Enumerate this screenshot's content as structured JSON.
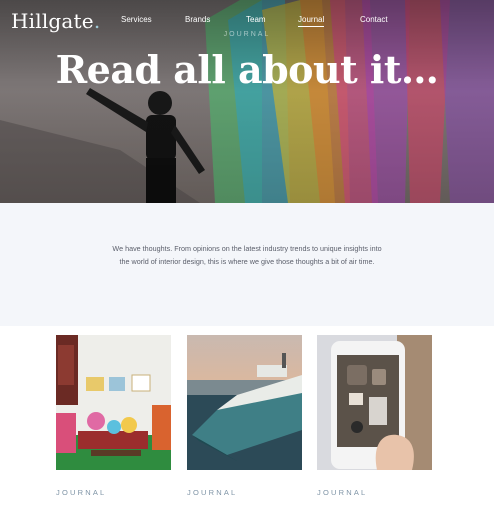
{
  "brand": {
    "name": "Hillgate",
    "dot": "."
  },
  "nav": {
    "items": [
      {
        "label": "Services"
      },
      {
        "label": "Brands"
      },
      {
        "label": "Team"
      },
      {
        "label": "Journal",
        "active": true
      },
      {
        "label": "Contact"
      }
    ]
  },
  "hero": {
    "eyebrow": "JOURNAL",
    "title": "Read all about it…"
  },
  "intro": {
    "text": "We have thoughts. From opinions on the latest industry trends to unique insights into the world of interior design, this is where we give those thoughts a bit of air time."
  },
  "cards": [
    {
      "category": "JOURNAL",
      "image": "colorful-living-room"
    },
    {
      "category": "JOURNAL",
      "image": "superyacht-at-sea"
    },
    {
      "category": "JOURNAL",
      "image": "phone-photo-of-desk"
    }
  ],
  "colors": {
    "intro_background": "#f4f6fa",
    "label": "#7f94a6",
    "logo_accent": "#9ec9d6"
  }
}
